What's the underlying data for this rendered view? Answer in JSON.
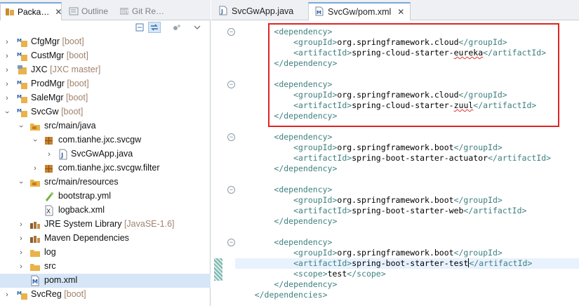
{
  "left_panel": {
    "tabs": [
      {
        "label": "Packa…",
        "close": "✕"
      },
      {
        "label": "Outline"
      },
      {
        "label": "Git Re…"
      }
    ],
    "tree": [
      {
        "label": "CfgMgr",
        "decoration": "[boot]",
        "icon": "maven-project-icon",
        "expanded": false
      },
      {
        "label": "CustMgr",
        "decoration": "[boot]",
        "icon": "maven-project-icon",
        "expanded": false
      },
      {
        "label": "JXC",
        "decoration": "[JXC master]",
        "icon": "git-project-icon",
        "expanded": false
      },
      {
        "label": "ProdMgr",
        "decoration": "[boot]",
        "icon": "maven-project-icon",
        "expanded": false
      },
      {
        "label": "SaleMgr",
        "decoration": "[boot]",
        "icon": "maven-project-icon",
        "expanded": false
      },
      {
        "label": "SvcGw",
        "decoration": "[boot]",
        "icon": "maven-project-icon",
        "expanded": true
      },
      {
        "label": "src/main/java",
        "decoration": "",
        "icon": "source-folder-icon",
        "expanded": true
      },
      {
        "label": "com.tianhe.jxc.svcgw",
        "decoration": "",
        "icon": "package-icon",
        "expanded": true
      },
      {
        "label": "SvcGwApp.java",
        "decoration": "",
        "icon": "java-file-icon",
        "expanded": false
      },
      {
        "label": "com.tianhe.jxc.svcgw.filter",
        "decoration": "",
        "icon": "package-icon",
        "expanded": false
      },
      {
        "label": "src/main/resources",
        "decoration": "",
        "icon": "source-folder-icon",
        "expanded": true
      },
      {
        "label": "bootstrap.yml",
        "decoration": "",
        "icon": "yml-file-icon",
        "expanded": false
      },
      {
        "label": "logback.xml",
        "decoration": "",
        "icon": "xml-file-icon",
        "expanded": false
      },
      {
        "label": "JRE System Library",
        "decoration": "[JavaSE-1.6]",
        "icon": "library-icon",
        "expanded": false
      },
      {
        "label": "Maven Dependencies",
        "decoration": "",
        "icon": "library-icon",
        "expanded": false
      },
      {
        "label": "log",
        "decoration": "",
        "icon": "folder-icon",
        "expanded": false
      },
      {
        "label": "src",
        "decoration": "",
        "icon": "folder-icon",
        "expanded": false
      },
      {
        "label": "pom.xml",
        "decoration": "",
        "icon": "maven-file-icon",
        "expanded": false
      },
      {
        "label": "SvcReg",
        "decoration": "[boot]",
        "icon": "maven-project-icon",
        "expanded": false
      }
    ]
  },
  "editor": {
    "tabs": [
      {
        "label": "SvcGwApp.java"
      },
      {
        "label": "SvcGw/pom.xml",
        "close": "✕"
      }
    ],
    "lines": [
      {
        "indent": "        ",
        "open": "<dependency>",
        "text": "",
        "close": ""
      },
      {
        "indent": "            ",
        "open": "<groupId>",
        "text": "org.springframework.cloud",
        "close": "</groupId>"
      },
      {
        "indent": "            ",
        "open": "<artifactId>",
        "text": "spring-cloud-starter-",
        "squig": "eureka",
        "close": "</artifactId>"
      },
      {
        "indent": "        ",
        "open": "</dependency>",
        "text": "",
        "close": ""
      },
      {
        "indent": "",
        "open": "",
        "text": "",
        "close": ""
      },
      {
        "indent": "        ",
        "open": "<dependency>",
        "text": "",
        "close": ""
      },
      {
        "indent": "            ",
        "open": "<groupId>",
        "text": "org.springframework.cloud",
        "close": "</groupId>"
      },
      {
        "indent": "            ",
        "open": "<artifactId>",
        "text": "spring-cloud-starter-",
        "squig": "zuul",
        "close": "</artifactId>"
      },
      {
        "indent": "        ",
        "open": "</dependency>",
        "text": "",
        "close": ""
      },
      {
        "indent": "",
        "open": "",
        "text": "",
        "close": ""
      },
      {
        "indent": "        ",
        "open": "<dependency>",
        "text": "",
        "close": ""
      },
      {
        "indent": "            ",
        "open": "<groupId>",
        "text": "org.springframework.boot",
        "close": "</groupId>"
      },
      {
        "indent": "            ",
        "open": "<artifactId>",
        "text": "spring-boot-starter-actuator",
        "close": "</artifactId>"
      },
      {
        "indent": "        ",
        "open": "</dependency>",
        "text": "",
        "close": ""
      },
      {
        "indent": "",
        "open": "",
        "text": "",
        "close": ""
      },
      {
        "indent": "        ",
        "open": "<dependency>",
        "text": "",
        "close": ""
      },
      {
        "indent": "            ",
        "open": "<groupId>",
        "text": "org.springframework.boot",
        "close": "</groupId>"
      },
      {
        "indent": "            ",
        "open": "<artifactId>",
        "text": "spring-boot-starter-web",
        "close": "</artifactId>"
      },
      {
        "indent": "        ",
        "open": "</dependency>",
        "text": "",
        "close": ""
      },
      {
        "indent": "",
        "open": "",
        "text": "",
        "close": ""
      },
      {
        "indent": "        ",
        "open": "<dependency>",
        "text": "",
        "close": ""
      },
      {
        "indent": "            ",
        "open": "<groupId>",
        "text": "org.springframework.boot",
        "close": "</groupId>"
      },
      {
        "indent": "            ",
        "open": "<artifactId>",
        "text": "spring-boot-starter-test",
        "close": "</artifactId>",
        "caret": true
      },
      {
        "indent": "            ",
        "open": "<scope>",
        "text": "test",
        "close": "</scope>"
      },
      {
        "indent": "        ",
        "open": "</dependency>",
        "text": "",
        "close": ""
      },
      {
        "indent": "    ",
        "open": "</dependencies>",
        "text": "",
        "close": ""
      }
    ]
  },
  "colors": {
    "tag": "#3f7f7f",
    "highlight_box": "#e02424",
    "selection": "#d6e6f7",
    "current_line": "#e8f2fe"
  }
}
